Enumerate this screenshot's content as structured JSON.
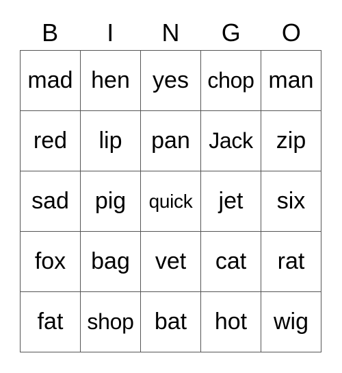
{
  "header": {
    "letters": [
      "B",
      "I",
      "N",
      "G",
      "O"
    ]
  },
  "board": {
    "rows": [
      [
        "mad",
        "hen",
        "yes",
        "chop",
        "man"
      ],
      [
        "red",
        "lip",
        "pan",
        "Jack",
        "zip"
      ],
      [
        "sad",
        "pig",
        "quick",
        "jet",
        "six"
      ],
      [
        "fox",
        "bag",
        "vet",
        "cat",
        "rat"
      ],
      [
        "fat",
        "shop",
        "bat",
        "hot",
        "wig"
      ]
    ]
  },
  "colors": {
    "grid_line": "#555555",
    "text": "#000000",
    "background": "#ffffff"
  }
}
